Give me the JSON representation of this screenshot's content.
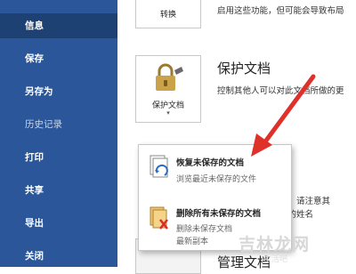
{
  "sidebar": {
    "items": [
      {
        "label": "信息",
        "active": true
      },
      {
        "label": "保存"
      },
      {
        "label": "另存为"
      },
      {
        "label": "历史记录",
        "dim": true
      },
      {
        "label": "打印"
      },
      {
        "label": "共享"
      },
      {
        "label": "导出"
      },
      {
        "label": "关闭"
      }
    ]
  },
  "convert": {
    "tile_label": "转换",
    "desc": "启用这些功能，但可能会导致布局"
  },
  "protect": {
    "tile_label": "保护文档",
    "title": "保护文档",
    "desc": "控制其他人可以对此文档所做的更"
  },
  "manage": {
    "title": "管理文档",
    "snippet_1": "期，请注意其",
    "snippet_2": "者的姓名"
  },
  "popup": {
    "recover": {
      "title": "恢复未保存的文档",
      "desc": "浏览最近未保存的文件"
    },
    "delete": {
      "title": "删除所有未保存的文档",
      "desc_1": "删除未保存文档",
      "desc_2": "最新副本"
    }
  },
  "watermark": {
    "text": "吉林龙网",
    "sub": "生活吧"
  },
  "colors": {
    "sidebar": "#2b579a",
    "sidebar_active": "#1e4173",
    "arrow": "#e0302a",
    "lock": "#c9a24a"
  }
}
